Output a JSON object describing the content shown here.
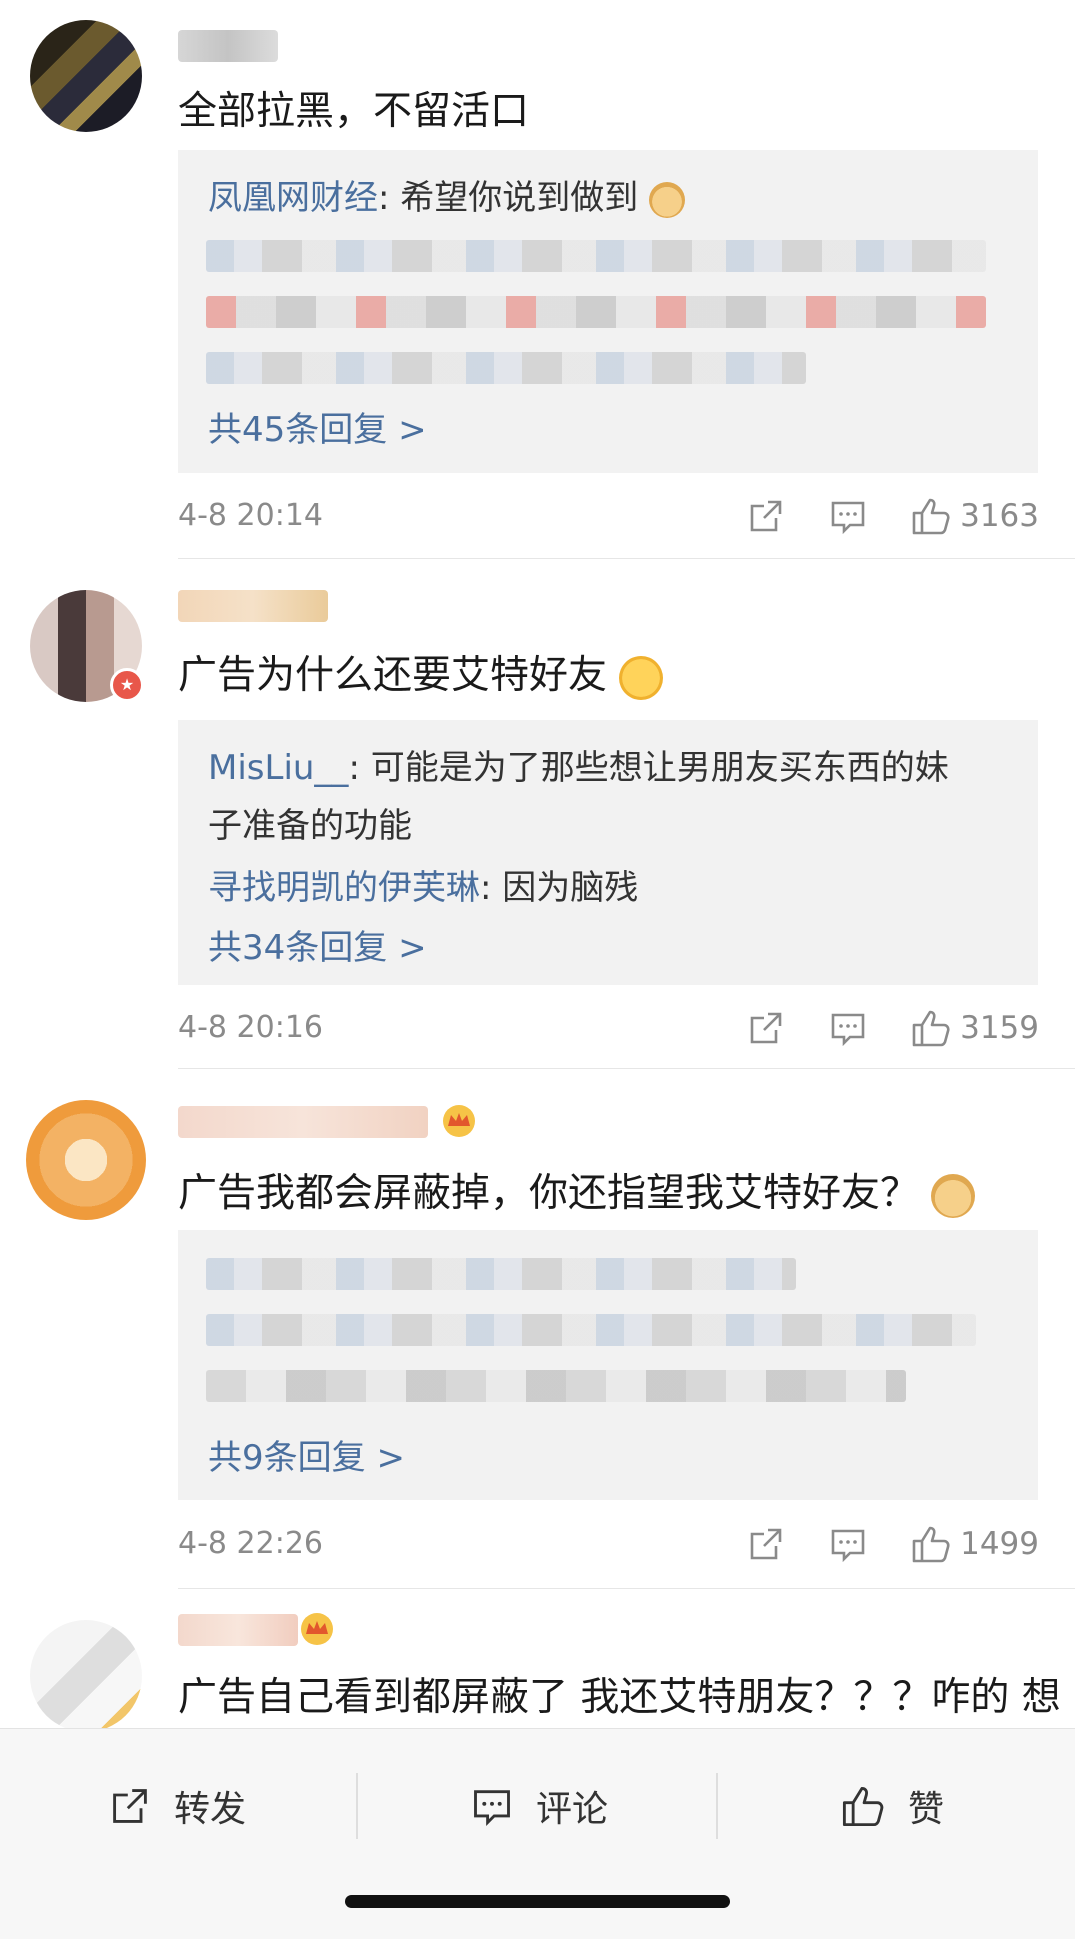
{
  "comments": [
    {
      "text": "全部拉黑，不留活口",
      "replies": [
        {
          "name": "凤凰网财经",
          "text": ": 希望你说到做到"
        }
      ],
      "more": "共45条回复 >",
      "time": "4-8 20:14",
      "likes": "3163"
    },
    {
      "text": "广告为什么还要艾特好友",
      "replies": [
        {
          "name": "MisLiu__",
          "text": ": 可能是为了那些想让男朋友买东西的妹",
          "cont": "子准备的功能"
        },
        {
          "name": "寻找明凯的伊芙琳",
          "text": ": 因为脑残"
        }
      ],
      "more": "共34条回复 >",
      "time": "4-8 20:16",
      "likes": "3159"
    },
    {
      "text": "广告我都会屏蔽掉，你还指望我艾特好友？",
      "replies": [],
      "more": "共9条回复 >",
      "time": "4-8 22:26",
      "likes": "1499"
    },
    {
      "text": "广告自己看到都屏蔽了 我还艾特朋友？？？咋的 想"
    }
  ],
  "toolbar": {
    "repost": "转发",
    "comment": "评论",
    "like": "赞"
  },
  "icons": {
    "share": "share-icon",
    "comment": "comment-icon",
    "like": "thumbs-up-icon"
  },
  "colors": {
    "link": "#4a6f9e",
    "reply_bg": "#f2f2f2",
    "meta": "#8a8a8a"
  }
}
